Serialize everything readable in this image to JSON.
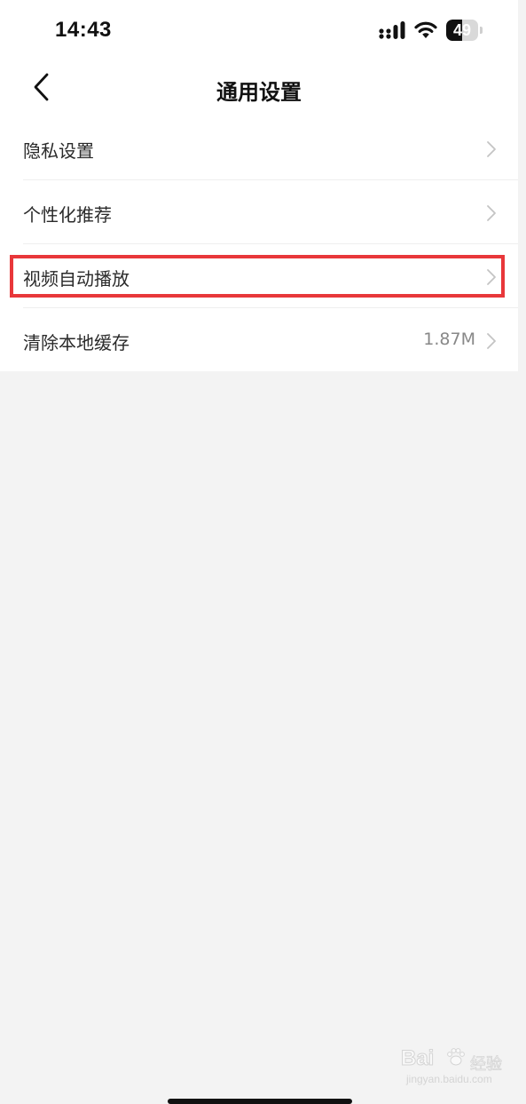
{
  "status_bar": {
    "time": "14:43",
    "battery_level": "49",
    "battery_fraction": 0.49,
    "signal_icon": "cellular-signal-icon",
    "wifi_icon": "wifi-icon",
    "battery_icon": "battery-icon"
  },
  "header": {
    "title": "通用设置",
    "back_icon": "chevron-left-icon"
  },
  "settings": {
    "items": [
      {
        "label": "隐私设置",
        "value": ""
      },
      {
        "label": "个性化推荐",
        "value": ""
      },
      {
        "label": "视频自动播放",
        "value": "",
        "highlighted": true
      },
      {
        "label": "清除本地缓存",
        "value": "1.87M"
      }
    ]
  },
  "watermark": {
    "brand": "Bai",
    "brand_suffix": "经验",
    "url": "jingyan.baidu.com"
  },
  "colors": {
    "background": "#f3f3f3",
    "card": "#ffffff",
    "highlight": "#e8373a",
    "chevron": "#c4c4c4",
    "value_text": "#888888"
  }
}
